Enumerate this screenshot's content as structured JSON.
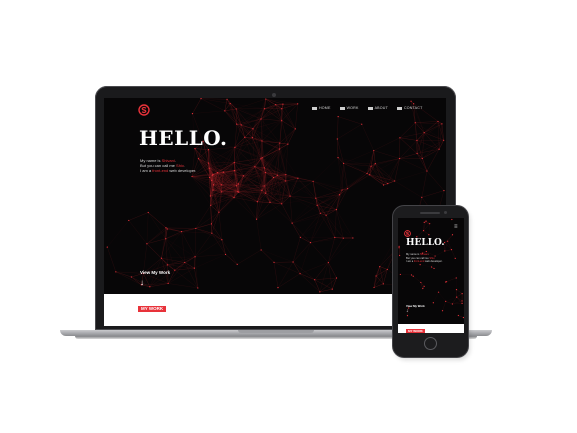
{
  "site": {
    "nav": [
      "HOME",
      "WORK",
      "ABOUT",
      "CONTACT"
    ],
    "heading": "HELLO.",
    "intro": [
      {
        "pre": "My name is ",
        "hl": "Shivani",
        "post": "."
      },
      {
        "pre": "But you can call me ",
        "hl": "Shiv",
        "post": "."
      },
      {
        "pre": "I am a ",
        "hl": "front-end",
        "post": " web developer."
      }
    ],
    "cta": "View My Work",
    "arrow": "↓",
    "section_label": "MY WORK"
  },
  "icons": {
    "logo": "s-logo-icon",
    "menu": "hamburger-menu-icon",
    "down": "down-arrow-icon"
  },
  "colors": {
    "accent": "#e8323a",
    "background": "#070607",
    "network": "#8a1e22"
  }
}
